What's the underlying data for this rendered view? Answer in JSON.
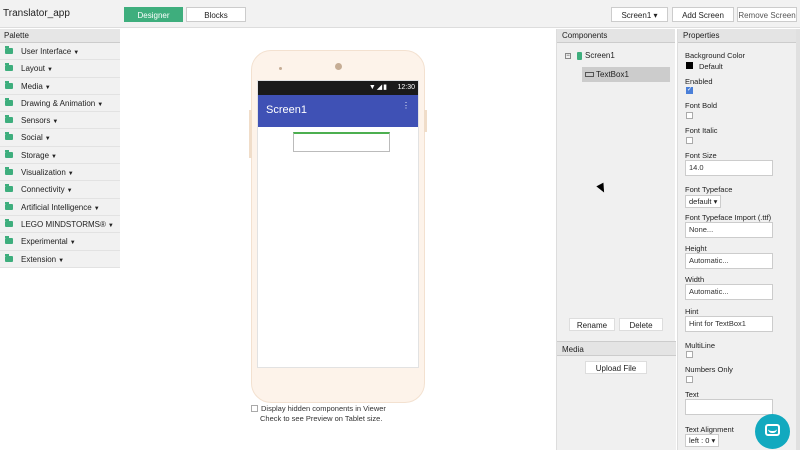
{
  "app": {
    "title": "Translator_app"
  },
  "tabs": {
    "designer": "Designer",
    "blocks": "Blocks"
  },
  "toolbar": {
    "screen_select": "Screen1 ▾",
    "add_screen": "Add Screen",
    "remove_screen": "Remove Screen"
  },
  "palette": {
    "header": "Palette",
    "items": [
      "User Interface",
      "Layout",
      "Media",
      "Drawing & Animation",
      "Sensors",
      "Social",
      "Storage",
      "Visualization",
      "Connectivity",
      "Artificial Intelligence",
      "LEGO MINDSTORMS®",
      "Experimental",
      "Extension"
    ]
  },
  "viewer": {
    "status_time": "12:30",
    "screen_title": "Screen1",
    "display_hidden": "Display hidden components in Viewer",
    "tablet_preview": "Check to see Preview on Tablet size."
  },
  "components": {
    "header": "Components",
    "root": "Screen1",
    "child": "TextBox1",
    "rename": "Rename",
    "delete": "Delete"
  },
  "media": {
    "header": "Media",
    "upload": "Upload File"
  },
  "properties": {
    "header": "Properties",
    "background_color_label": "Background Color",
    "background_color_value": "Default",
    "enabled_label": "Enabled",
    "font_bold_label": "Font Bold",
    "font_italic_label": "Font Italic",
    "font_size_label": "Font Size",
    "font_size_value": "14.0",
    "font_typeface_label": "Font Typeface",
    "font_typeface_value": "default ▾",
    "font_typeface_import_label": "Font Typeface Import (.ttf)",
    "font_typeface_import_value": "None...",
    "height_label": "Height",
    "height_value": "Automatic...",
    "width_label": "Width",
    "width_value": "Automatic...",
    "hint_label": "Hint",
    "hint_value": "Hint for TextBox1",
    "multiline_label": "MultiLine",
    "numbers_only_label": "Numbers Only",
    "text_label": "Text",
    "text_value": "",
    "text_alignment_label": "Text Alignment",
    "text_alignment_value": "left : 0 ▾"
  },
  "colors": {
    "accent": "#3eae7d",
    "appbar": "#3f51b5",
    "statusbar": "#1a1a1a"
  }
}
